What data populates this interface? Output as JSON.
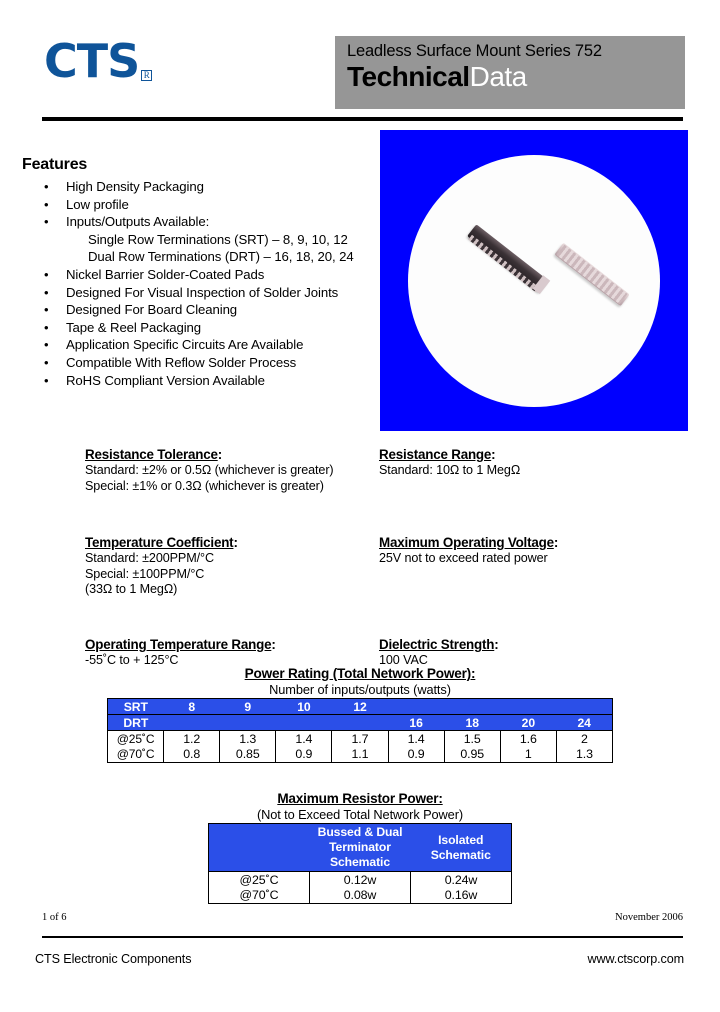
{
  "header": {
    "logo_text": "CTS",
    "logo_reg_mark": "R",
    "banner_line1": "Leadless Surface Mount Series 752",
    "banner_word_bold": "Technical",
    "banner_word_light": "Data",
    "banner_bg_color": "#969696",
    "logo_color": "#0f5499"
  },
  "features": {
    "title": "Features",
    "items": [
      "High Density Packaging",
      "Low profile",
      "Inputs/Outputs Available:",
      "Nickel Barrier Solder-Coated Pads",
      "Designed For Visual Inspection of Solder Joints",
      "Designed For Board Cleaning",
      "Tape & Reel Packaging",
      "Application Specific Circuits Are Available",
      "Compatible With Reflow Solder Process",
      "RoHS Compliant Version Available"
    ],
    "sub_items": [
      "Single Row Terminations (SRT) – 8, 9, 10, 12",
      "Dual Row Terminations (DRT) – 16, 18, 20, 24"
    ],
    "bullet_glyph": "•"
  },
  "product_image": {
    "background_color": "#0000ff",
    "circle_color": "#ffffff",
    "caption": "two leadless surface mount resistor networks"
  },
  "specs": {
    "left": [
      {
        "title": "Resistance Tolerance",
        "lines": [
          "Standard: ±2% or 0.5Ω (whichever is greater)",
          "Special: ±1% or 0.3Ω (whichever is greater)"
        ]
      },
      {
        "title": "Temperature Coefficient",
        "lines": [
          "Standard: ±200PPM/°C",
          "Special: ±100PPM/°C",
          "(33Ω to 1 MegΩ)"
        ]
      },
      {
        "title": "Operating Temperature Range",
        "lines": [
          "-55˚C to + 125°C"
        ]
      }
    ],
    "right": [
      {
        "title": "Resistance Range",
        "lines": [
          "Standard:  10Ω to 1 MegΩ"
        ]
      },
      {
        "title": "Maximum Operating Voltage",
        "lines": [
          "25V not to exceed rated power"
        ]
      },
      {
        "title": "Dielectric Strength",
        "lines": [
          "100 VAC"
        ]
      }
    ]
  },
  "power_rating_table": {
    "title": "Power Rating (Total Network Power):",
    "subtitle": "Number of inputs/outputs (watts)",
    "header_bg_color": "#2b4fe8",
    "srt_label": "SRT",
    "drt_label": "DRT",
    "srt_values": [
      "8",
      "9",
      "10",
      "12",
      "",
      "",
      "",
      ""
    ],
    "drt_values": [
      "",
      "",
      "",
      "",
      "16",
      "18",
      "20",
      "24"
    ],
    "rows": [
      {
        "label": "@25˚C",
        "values": [
          "1.2",
          "1.3",
          "1.4",
          "1.7",
          "1.4",
          "1.5",
          "1.6",
          "2"
        ]
      },
      {
        "label": "@70˚C",
        "values": [
          "0.8",
          "0.85",
          "0.9",
          "1.1",
          "0.9",
          "0.95",
          "1",
          "1.3"
        ]
      }
    ]
  },
  "max_resistor_table": {
    "title": "Maximum Resistor Power:",
    "subtitle": "(Not to Exceed Total Network Power)",
    "header_bg_color": "#2b4fe8",
    "col_blank": "",
    "col_bussed_line1": "Bussed & Dual",
    "col_bussed_line2": "Terminator Schematic",
    "col_isolated_line1": "Isolated",
    "col_isolated_line2": "Schematic",
    "rows": [
      {
        "label": "@25˚C",
        "bussed": "0.12w",
        "isolated": "0.24w"
      },
      {
        "label": "@70˚C",
        "bussed": "0.08w",
        "isolated": "0.16w"
      }
    ]
  },
  "footer": {
    "page": "1 of 6",
    "date": "November 2006",
    "company": "CTS Electronic Components",
    "url": "www.ctscorp.com"
  }
}
